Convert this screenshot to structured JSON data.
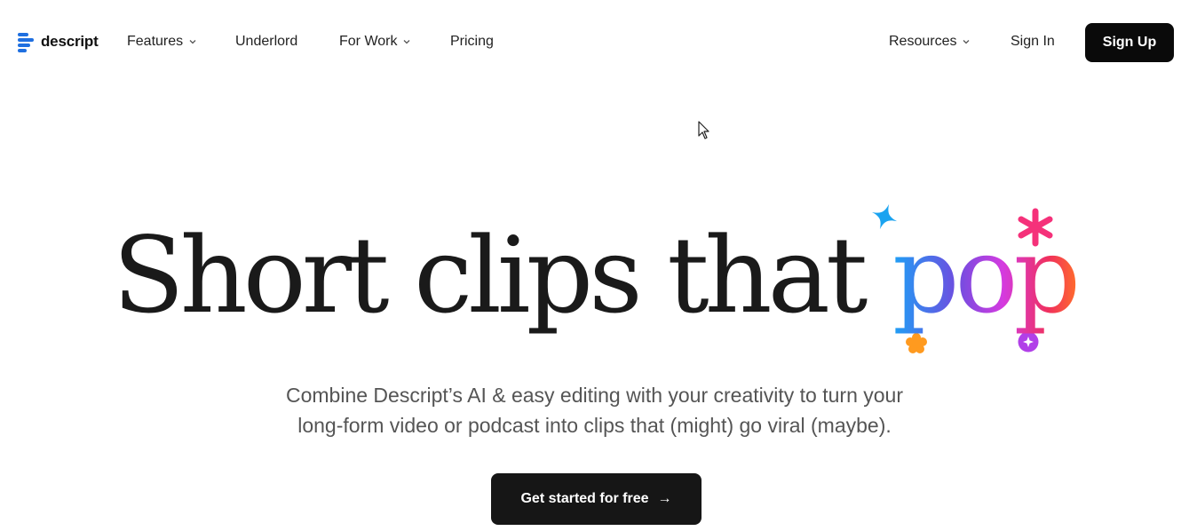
{
  "brand": {
    "name": "descript",
    "accent": "#1f6fe0"
  },
  "nav": {
    "features": "Features",
    "underlord": "Underlord",
    "for_work": "For Work",
    "pricing": "Pricing",
    "resources": "Resources",
    "sign_in": "Sign In",
    "sign_up": "Sign Up"
  },
  "hero": {
    "headline_main": "Short clips that ",
    "headline_accent": "pop",
    "subtitle_line1": "Combine Descript’s AI & easy editing with your creativity to turn your",
    "subtitle_line2": "long-form video or podcast into clips that (might) go viral (maybe).",
    "cta_label": "Get started for free",
    "cta_arrow": "→"
  },
  "decorations": {
    "sparkle_color": "#1aa3f0",
    "asterisk_color": "#f5317a",
    "flower_color": "#ff9a1f",
    "badge_color": "#b140e8"
  }
}
